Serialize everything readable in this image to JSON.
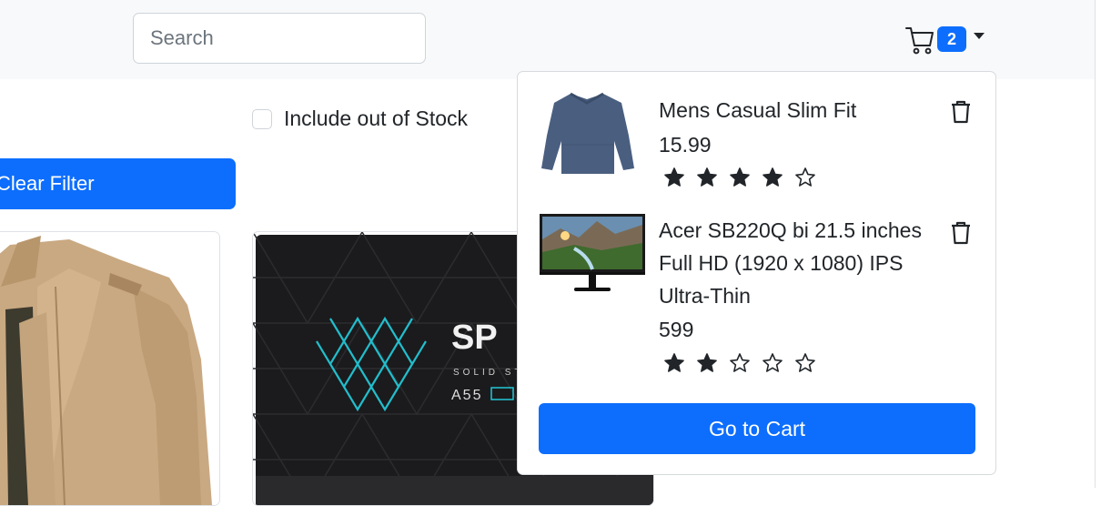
{
  "search": {
    "placeholder": "Search"
  },
  "cart": {
    "count": "2"
  },
  "filters": {
    "include_out_of_stock": "Include out of Stock",
    "clear_filter": "Clear Filter"
  },
  "cart_dropdown": {
    "items": [
      {
        "title": "Mens Casual Slim Fit",
        "price": "15.99",
        "rating": 4
      },
      {
        "title": "Acer SB220Q bi 21.5 inches Full HD (1920 x 1080) IPS Ultra-Thin",
        "price": "599",
        "rating": 2
      }
    ],
    "go_to_cart": "Go to Cart"
  },
  "product_images": {
    "ssd_brand": "SP",
    "ssd_line": "SOLID ST",
    "ssd_model": "A55"
  },
  "colors": {
    "primary": "#0d6efd",
    "navbar": "#f8f9fa"
  }
}
